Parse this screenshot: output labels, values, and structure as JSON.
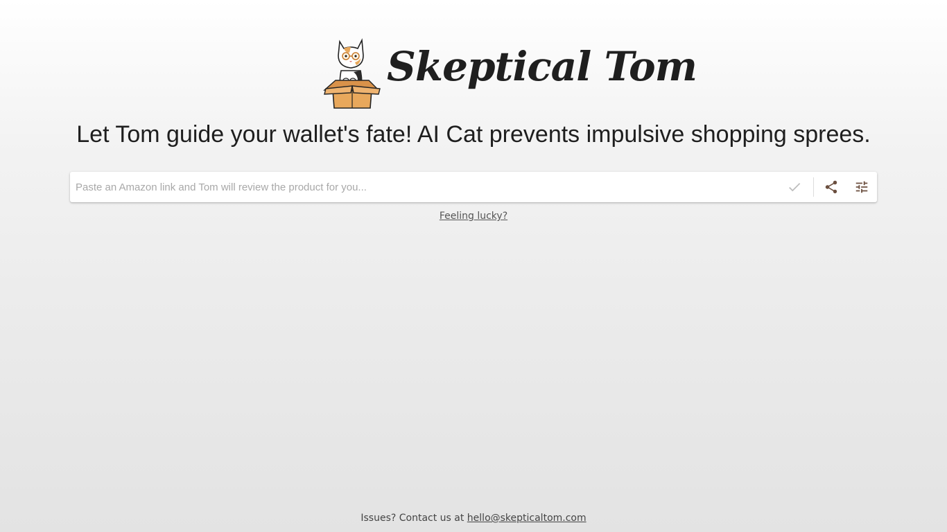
{
  "brand": {
    "name": "Skeptical Tom",
    "logo_icon": "cat-in-box-icon"
  },
  "tagline": "Let Tom guide your wallet's fate! AI Cat prevents impulsive shopping sprees.",
  "search": {
    "placeholder": "Paste an Amazon link and Tom will review the product for you...",
    "value": "",
    "submit_icon": "check-icon",
    "share_icon": "share-icon",
    "settings_icon": "tune-icon"
  },
  "lucky_link": "Feeling lucky?",
  "footer": {
    "text": "Issues? Contact us at ",
    "email": "hello@skepticaltom.com"
  },
  "colors": {
    "box_orange": "#e8a85c",
    "text_dark": "#1e1e1e",
    "icon_brown": "#6b4f3f",
    "check_gray": "#bdbdbd"
  }
}
